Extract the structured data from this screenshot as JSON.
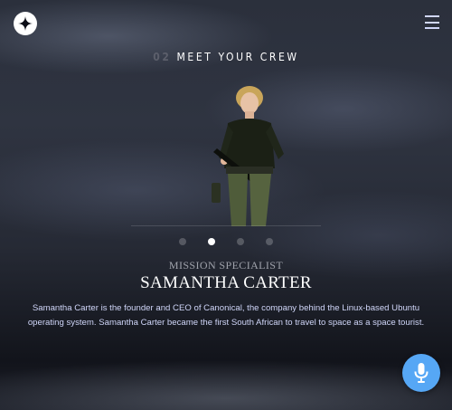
{
  "header": {
    "logo_icon": "star-logo-icon",
    "menu_icon": "hamburger-menu-icon"
  },
  "section": {
    "number": "02",
    "title": "MEET YOUR CREW"
  },
  "crew_member": {
    "role": "MISSION SPECIALIST",
    "name": "SAMANTHA CARTER",
    "bio": "Samantha Carter is the founder and CEO of Canonical, the company behind the Linux-based Ubuntu operating system. Samantha Carter became the first South African to travel to space as a space tourist."
  },
  "carousel": {
    "dot_count": 4,
    "active_index": 1
  },
  "voice_button": {
    "icon": "microphone-icon",
    "color": "#56a7f5"
  },
  "colors": {
    "accent_text": "#d0d6f9",
    "dim_number": "#5c5f6b",
    "role_text": "#9fa2ab"
  }
}
